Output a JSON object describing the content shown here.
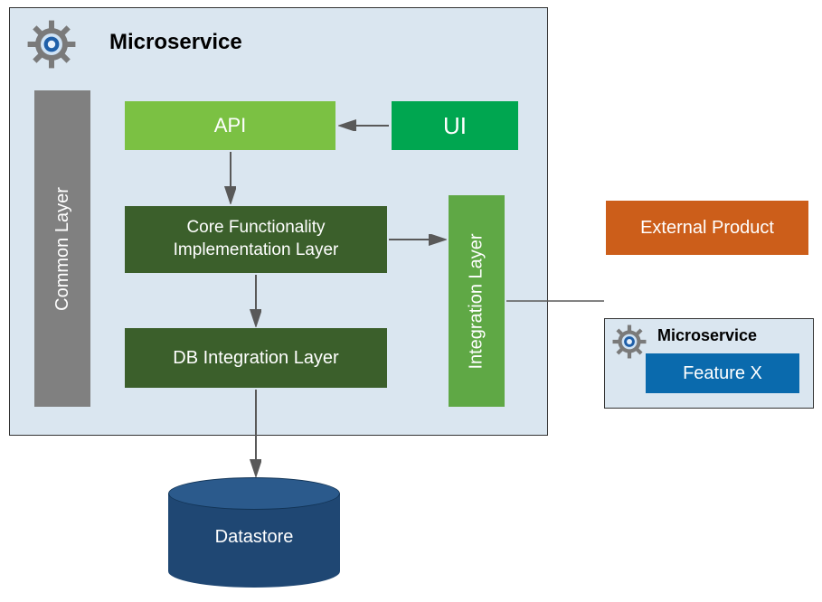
{
  "main": {
    "title": "Microservice",
    "common_layer": "Common Layer",
    "api": "API",
    "ui": "UI",
    "core_line1": "Core Functionality",
    "core_line2": "Implementation Layer",
    "db_layer": "DB Integration Layer",
    "integration": "Integration Layer"
  },
  "external": {
    "product": "External Product"
  },
  "micro2": {
    "title": "Microservice",
    "feature": "Feature X"
  },
  "datastore": {
    "label": "Datastore"
  }
}
